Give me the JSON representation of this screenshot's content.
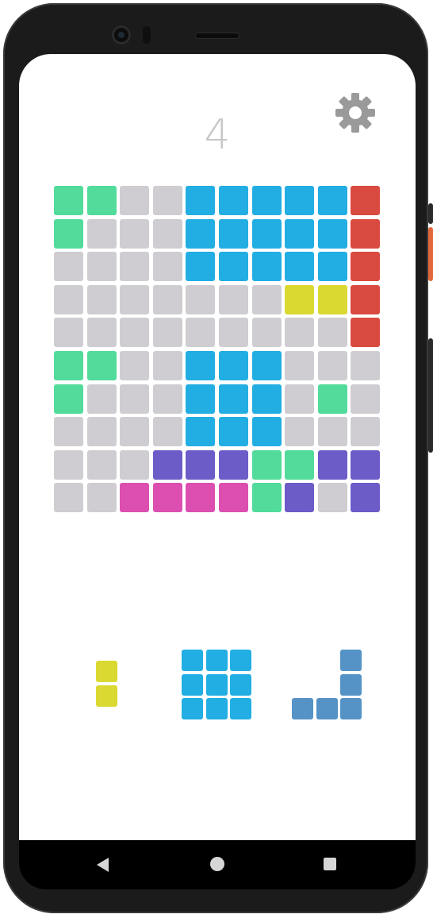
{
  "game": {
    "score": "4",
    "colors": {
      "empty": "#cfcdd1",
      "green": "#52db9b",
      "blue": "#22aee2",
      "red": "#d94a40",
      "yellow": "#d9d931",
      "purple": "#6c5cc8",
      "pink": "#dc4fb1",
      "steel": "#5593c6"
    },
    "board": [
      [
        "green",
        "green",
        "empty",
        "empty",
        "blue",
        "blue",
        "blue",
        "blue",
        "blue",
        "red"
      ],
      [
        "green",
        "empty",
        "empty",
        "empty",
        "blue",
        "blue",
        "blue",
        "blue",
        "blue",
        "red"
      ],
      [
        "empty",
        "empty",
        "empty",
        "empty",
        "blue",
        "blue",
        "blue",
        "blue",
        "blue",
        "red"
      ],
      [
        "empty",
        "empty",
        "empty",
        "empty",
        "empty",
        "empty",
        "empty",
        "yellow",
        "yellow",
        "red"
      ],
      [
        "empty",
        "empty",
        "empty",
        "empty",
        "empty",
        "empty",
        "empty",
        "empty",
        "empty",
        "red"
      ],
      [
        "green",
        "green",
        "empty",
        "empty",
        "blue",
        "blue",
        "blue",
        "empty",
        "empty",
        "empty"
      ],
      [
        "green",
        "empty",
        "empty",
        "empty",
        "blue",
        "blue",
        "blue",
        "empty",
        "green",
        "empty"
      ],
      [
        "empty",
        "empty",
        "empty",
        "empty",
        "blue",
        "blue",
        "blue",
        "empty",
        "empty",
        "empty"
      ],
      [
        "empty",
        "empty",
        "empty",
        "purple",
        "purple",
        "purple",
        "green",
        "green",
        "purple",
        "purple"
      ],
      [
        "empty",
        "empty",
        "pink",
        "pink",
        "pink",
        "pink",
        "green",
        "purple",
        "empty",
        "purple"
      ]
    ],
    "pieces": [
      {
        "name": "vertical-domino",
        "color": "yellow",
        "shape": [
          [
            1
          ],
          [
            1
          ]
        ]
      },
      {
        "name": "square-3x3",
        "color": "blue",
        "shape": [
          [
            1,
            1,
            1
          ],
          [
            1,
            1,
            1
          ],
          [
            1,
            1,
            1
          ]
        ]
      },
      {
        "name": "corner-j",
        "color": "steel",
        "shape": [
          [
            0,
            0,
            1
          ],
          [
            0,
            0,
            1
          ],
          [
            1,
            1,
            1
          ]
        ]
      }
    ]
  },
  "icons": {
    "settings": "gear-icon",
    "back": "back-icon",
    "home": "home-icon",
    "recents": "recents-icon"
  }
}
